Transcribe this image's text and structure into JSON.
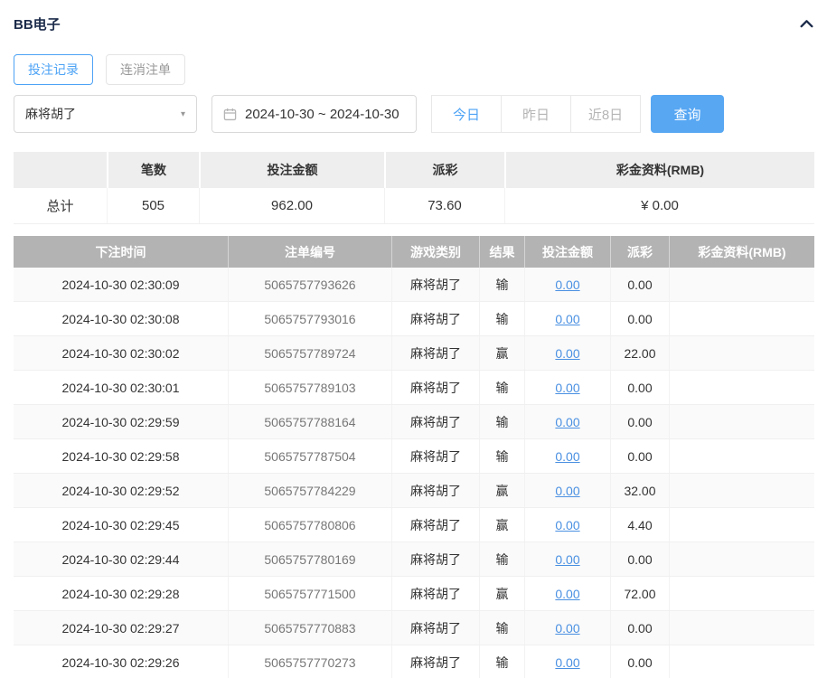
{
  "header": {
    "title": "BB电子"
  },
  "tabs": [
    {
      "label": "投注记录"
    },
    {
      "label": "连消注单"
    }
  ],
  "filters": {
    "game_select": "麻将胡了",
    "date_range": "2024-10-30 ~ 2024-10-30",
    "quick_ranges": [
      {
        "label": "今日"
      },
      {
        "label": "昨日"
      },
      {
        "label": "近8日"
      }
    ],
    "query_label": "查询"
  },
  "summary": {
    "headers": [
      "",
      "笔数",
      "投注金额",
      "派彩",
      "彩金资料(RMB)"
    ],
    "total": {
      "label": "总计",
      "count": "505",
      "bet_amount": "962.00",
      "payout": "73.60",
      "bonus": "¥ 0.00"
    }
  },
  "table": {
    "headers": [
      "下注时间",
      "注单编号",
      "游戏类别",
      "结果",
      "投注金额",
      "派彩",
      "彩金资料(RMB)"
    ],
    "rows": [
      {
        "time": "2024-10-30 02:30:09",
        "bet_id": "5065757793626",
        "game": "麻将胡了",
        "result": "输",
        "amount": "0.00",
        "payout": "0.00",
        "bonus": ""
      },
      {
        "time": "2024-10-30 02:30:08",
        "bet_id": "5065757793016",
        "game": "麻将胡了",
        "result": "输",
        "amount": "0.00",
        "payout": "0.00",
        "bonus": ""
      },
      {
        "time": "2024-10-30 02:30:02",
        "bet_id": "5065757789724",
        "game": "麻将胡了",
        "result": "赢",
        "amount": "0.00",
        "payout": "22.00",
        "bonus": ""
      },
      {
        "time": "2024-10-30 02:30:01",
        "bet_id": "5065757789103",
        "game": "麻将胡了",
        "result": "输",
        "amount": "0.00",
        "payout": "0.00",
        "bonus": ""
      },
      {
        "time": "2024-10-30 02:29:59",
        "bet_id": "5065757788164",
        "game": "麻将胡了",
        "result": "输",
        "amount": "0.00",
        "payout": "0.00",
        "bonus": ""
      },
      {
        "time": "2024-10-30 02:29:58",
        "bet_id": "5065757787504",
        "game": "麻将胡了",
        "result": "输",
        "amount": "0.00",
        "payout": "0.00",
        "bonus": ""
      },
      {
        "time": "2024-10-30 02:29:52",
        "bet_id": "5065757784229",
        "game": "麻将胡了",
        "result": "赢",
        "amount": "0.00",
        "payout": "32.00",
        "bonus": ""
      },
      {
        "time": "2024-10-30 02:29:45",
        "bet_id": "5065757780806",
        "game": "麻将胡了",
        "result": "赢",
        "amount": "0.00",
        "payout": "4.40",
        "bonus": ""
      },
      {
        "time": "2024-10-30 02:29:44",
        "bet_id": "5065757780169",
        "game": "麻将胡了",
        "result": "输",
        "amount": "0.00",
        "payout": "0.00",
        "bonus": ""
      },
      {
        "time": "2024-10-30 02:29:28",
        "bet_id": "5065757771500",
        "game": "麻将胡了",
        "result": "赢",
        "amount": "0.00",
        "payout": "72.00",
        "bonus": ""
      },
      {
        "time": "2024-10-30 02:29:27",
        "bet_id": "5065757770883",
        "game": "麻将胡了",
        "result": "输",
        "amount": "0.00",
        "payout": "0.00",
        "bonus": ""
      },
      {
        "time": "2024-10-30 02:29:26",
        "bet_id": "5065757770273",
        "game": "麻将胡了",
        "result": "输",
        "amount": "0.00",
        "payout": "0.00",
        "bonus": ""
      }
    ]
  },
  "colors": {
    "accent": "#4da3f5",
    "query_button": "#57a7f3",
    "table_header_bg": "#b3b3b3",
    "link": "#4a90e2",
    "title": "#1c2b4a"
  }
}
